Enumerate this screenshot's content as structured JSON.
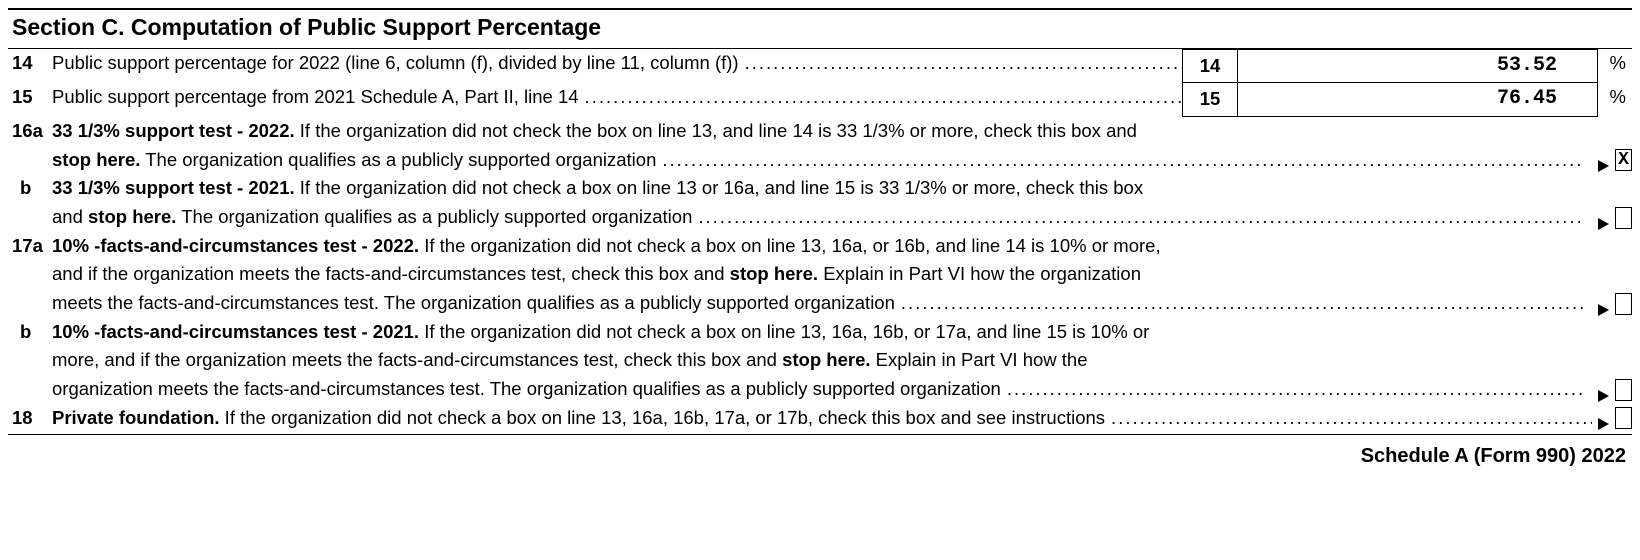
{
  "section_title": "Section C. Computation of Public Support Percentage",
  "line14": {
    "num": "14",
    "text": "Public support percentage for 2022 (line 6, column (f), divided by line 11, column (f))",
    "box": "14",
    "value": "53.52",
    "pct": "%"
  },
  "line15": {
    "num": "15",
    "text": "Public support percentage from 2021 Schedule A, Part II, line 14",
    "box": "15",
    "value": "76.45",
    "pct": "%"
  },
  "line16a": {
    "num": "16a",
    "bold1": "33 1/3% support test - 2022.",
    "text1": " If the organization did not check the box on line 13, and line 14 is 33 1/3% or more, check this box and",
    "bold2": "stop here.",
    "text2": " The organization qualifies as a publicly supported organization",
    "checked": "X"
  },
  "line16b": {
    "label": "b",
    "bold1": "33 1/3% support test - 2021.",
    "text1": " If the organization did not check a box on line 13 or 16a, and line 15 is 33 1/3% or more, check this box",
    "text2a": "and ",
    "bold2": "stop here.",
    "text2b": " The organization qualifies as a publicly supported organization",
    "checked": ""
  },
  "line17a": {
    "num": "17a",
    "bold1": "10% -facts-and-circumstances test - 2022.",
    "text1": " If the organization did not check a box on line 13, 16a, or 16b, and line 14 is 10% or more,",
    "text2a": "and if the organization meets the facts-and-circumstances test, check this box and ",
    "bold2": "stop here.",
    "text2b": " Explain in Part VI how the organization",
    "text3": "meets the facts-and-circumstances test. The organization qualifies as a publicly supported organization",
    "checked": ""
  },
  "line17b": {
    "label": "b",
    "bold1": "10% -facts-and-circumstances test - 2021.",
    "text1": " If the organization did not check a box on line 13, 16a, 16b, or 17a, and line 15 is 10% or",
    "text2a": "more, and if the organization meets the facts-and-circumstances test, check this box and ",
    "bold2": "stop here.",
    "text2b": " Explain in Part VI how the",
    "text3": "organization meets the facts-and-circumstances test. The organization qualifies as a publicly supported organization",
    "checked": ""
  },
  "line18": {
    "num": "18",
    "bold1": "Private foundation.",
    "text1": " If the organization did not check a box on line 13, 16a, 16b, 17a, or 17b, check this box and see instructions",
    "checked": ""
  },
  "footer": "Schedule A (Form 990) 2022"
}
